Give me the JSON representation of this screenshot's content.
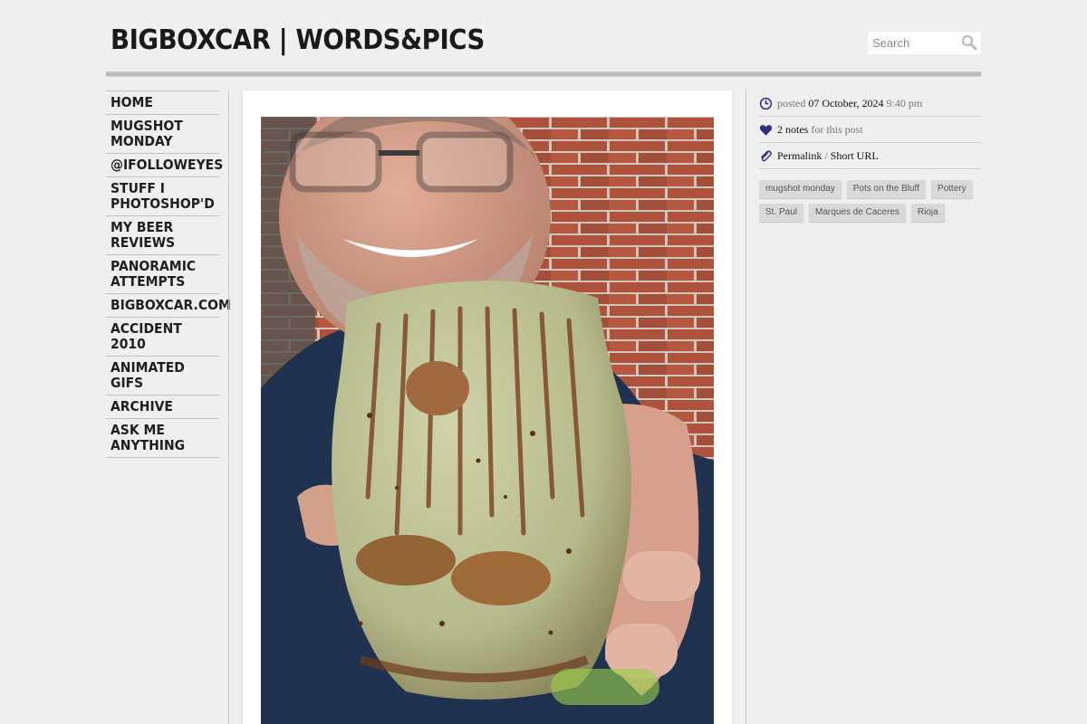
{
  "header": {
    "title": "BIGBOXCAR | WORDS&PICS",
    "search_placeholder": "Search"
  },
  "nav": {
    "items": [
      {
        "label": "HOME"
      },
      {
        "label": "MUGSHOT\nMONDAY"
      },
      {
        "label": "@IFOLLOWEYES"
      },
      {
        "label": "STUFF I\nPHOTOSHOP'D"
      },
      {
        "label": "MY BEER\nREVIEWS"
      },
      {
        "label": "PANORAMIC\nATTEMPTS"
      },
      {
        "label": "BIGBOXCAR.COM"
      },
      {
        "label": "ACCIDENT 2010"
      },
      {
        "label": "ANIMATED GIFS"
      },
      {
        "label": "ARCHIVE"
      },
      {
        "label": "ASK ME\nANYTHING"
      }
    ]
  },
  "post": {
    "photo_subject": "man holding speckled green and rust ceramic cup in front of brick wall"
  },
  "meta": {
    "posted_prefix": "posted",
    "posted_date": "07 October, 2024",
    "posted_time": "9:40 pm",
    "notes_count": "2 notes",
    "notes_suffix": "for this post",
    "permalink_label": "Permalink",
    "separator": "/",
    "short_url_label": "Short URL",
    "icons": {
      "time": "clock-icon",
      "notes": "heart-icon",
      "link": "paperclip-icon"
    },
    "icon_color": "#2d2f86"
  },
  "tags": [
    "mugshot monday",
    "Pots on the Bluff",
    "Pottery",
    "St. Paul",
    "Marques de Caceres",
    "Rioja"
  ]
}
